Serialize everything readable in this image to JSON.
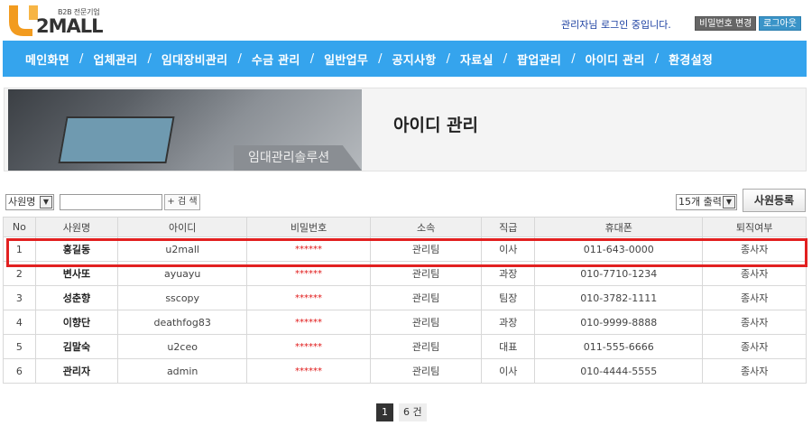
{
  "header": {
    "logo_small": "B2B 전문기업",
    "logo_main": "2MALL",
    "login_message": "관리자님 로그인 중입니다.",
    "password_change": "비밀번호 변경",
    "logout": "로그아웃"
  },
  "nav": [
    "메인화면",
    "업체관리",
    "임대장비관리",
    "수금 관리",
    "일반업무",
    "공지사항",
    "자료실",
    "팝업관리",
    "아이디 관리",
    "환경설정"
  ],
  "nav_separator": "/",
  "banner": {
    "tag": "임대관리솔루션",
    "title": "아이디 관리"
  },
  "search": {
    "field_select": "사원명",
    "input_value": "",
    "button": "+ 검 색"
  },
  "toolbar": {
    "count_select": "15개 출력",
    "register": "사원등록"
  },
  "table": {
    "columns": [
      "No",
      "사원명",
      "아이디",
      "비밀번호",
      "소속",
      "직급",
      "휴대폰",
      "퇴직여부"
    ],
    "rows": [
      [
        "1",
        "홍길동",
        "u2mall",
        "******",
        "관리팀",
        "이사",
        "011-643-0000",
        "종사자"
      ],
      [
        "2",
        "변사또",
        "ayuayu",
        "******",
        "관리팀",
        "과장",
        "010-7710-1234",
        "종사자"
      ],
      [
        "3",
        "성춘향",
        "sscopy",
        "******",
        "관리팀",
        "팀장",
        "010-3782-1111",
        "종사자"
      ],
      [
        "4",
        "이향단",
        "deathfog83",
        "******",
        "관리팀",
        "과장",
        "010-9999-8888",
        "종사자"
      ],
      [
        "5",
        "김말숙",
        "u2ceo",
        "******",
        "관리팀",
        "대표",
        "011-555-6666",
        "종사자"
      ],
      [
        "6",
        "관리자",
        "admin",
        "******",
        "관리팀",
        "이사",
        "010-4444-5555",
        "종사자"
      ]
    ]
  },
  "pagination": {
    "current": "1",
    "total": "6 건"
  },
  "colors": {
    "nav_bg": "#35a4ed",
    "highlight": "#e22020",
    "password_text": "#e01818",
    "login_text": "#1a3ea0"
  },
  "icons": [
    "chevron-down-icon"
  ]
}
